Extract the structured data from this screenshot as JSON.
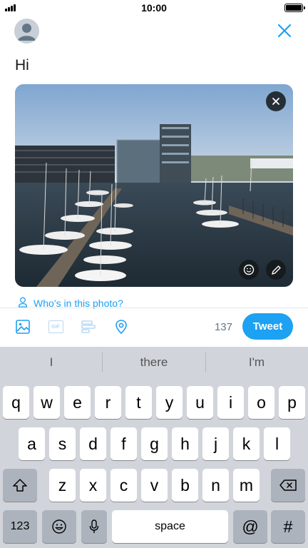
{
  "status_bar": {
    "time": "10:00"
  },
  "compose": {
    "text": "Hi",
    "who_tag": "Who’s in this photo?",
    "char_count": "137",
    "tweet_label": "Tweet"
  },
  "toolbar": {
    "gif_label": "GIF"
  },
  "keyboard": {
    "suggestions": [
      "I",
      "there",
      "I'm"
    ],
    "row1": [
      "q",
      "w",
      "e",
      "r",
      "t",
      "y",
      "u",
      "i",
      "o",
      "p"
    ],
    "row2": [
      "a",
      "s",
      "d",
      "f",
      "g",
      "h",
      "j",
      "k",
      "l"
    ],
    "row3": [
      "z",
      "x",
      "c",
      "v",
      "b",
      "n",
      "m"
    ],
    "numbers_label": "123",
    "space_label": "space",
    "at_label": "@",
    "hash_label": "#"
  },
  "colors": {
    "accent": "#1da1f2",
    "keyboard_bg": "#d1d5db",
    "function_key": "#adb3bc"
  },
  "icons": [
    "signal-icon",
    "battery-icon",
    "avatar-icon",
    "close-icon",
    "remove-photo-icon",
    "sticker-icon",
    "edit-photo-icon",
    "person-tag-icon",
    "image-icon",
    "gif-icon",
    "poll-icon",
    "location-icon",
    "shift-icon",
    "backspace-icon",
    "emoji-icon",
    "microphone-icon"
  ]
}
